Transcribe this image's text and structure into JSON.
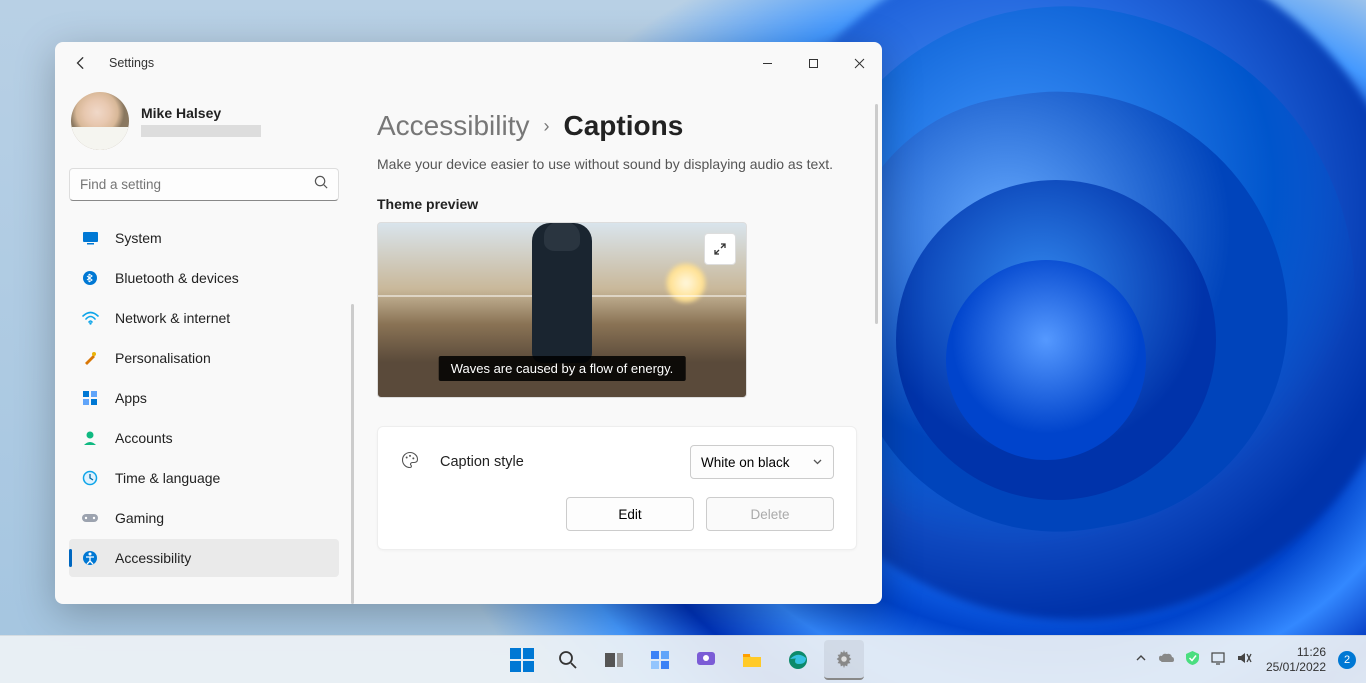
{
  "window": {
    "title": "Settings",
    "breadcrumb": {
      "parent": "Accessibility",
      "current": "Captions"
    },
    "subtitle": "Make your device easier to use without sound by displaying audio as text.",
    "profile": {
      "name": "Mike Halsey"
    },
    "search": {
      "placeholder": "Find a setting"
    },
    "nav": {
      "items": [
        {
          "label": "System"
        },
        {
          "label": "Bluetooth & devices"
        },
        {
          "label": "Network & internet"
        },
        {
          "label": "Personalisation"
        },
        {
          "label": "Apps"
        },
        {
          "label": "Accounts"
        },
        {
          "label": "Time & language"
        },
        {
          "label": "Gaming"
        },
        {
          "label": "Accessibility"
        }
      ]
    },
    "preview": {
      "section_label": "Theme preview",
      "caption_text": "Waves are caused by a flow of energy."
    },
    "caption_style": {
      "label": "Caption style",
      "selected": "White on black",
      "edit": "Edit",
      "delete": "Delete"
    }
  },
  "taskbar": {
    "datetime": {
      "time": "11:26",
      "date": "25/01/2022"
    },
    "notifications": "2"
  }
}
